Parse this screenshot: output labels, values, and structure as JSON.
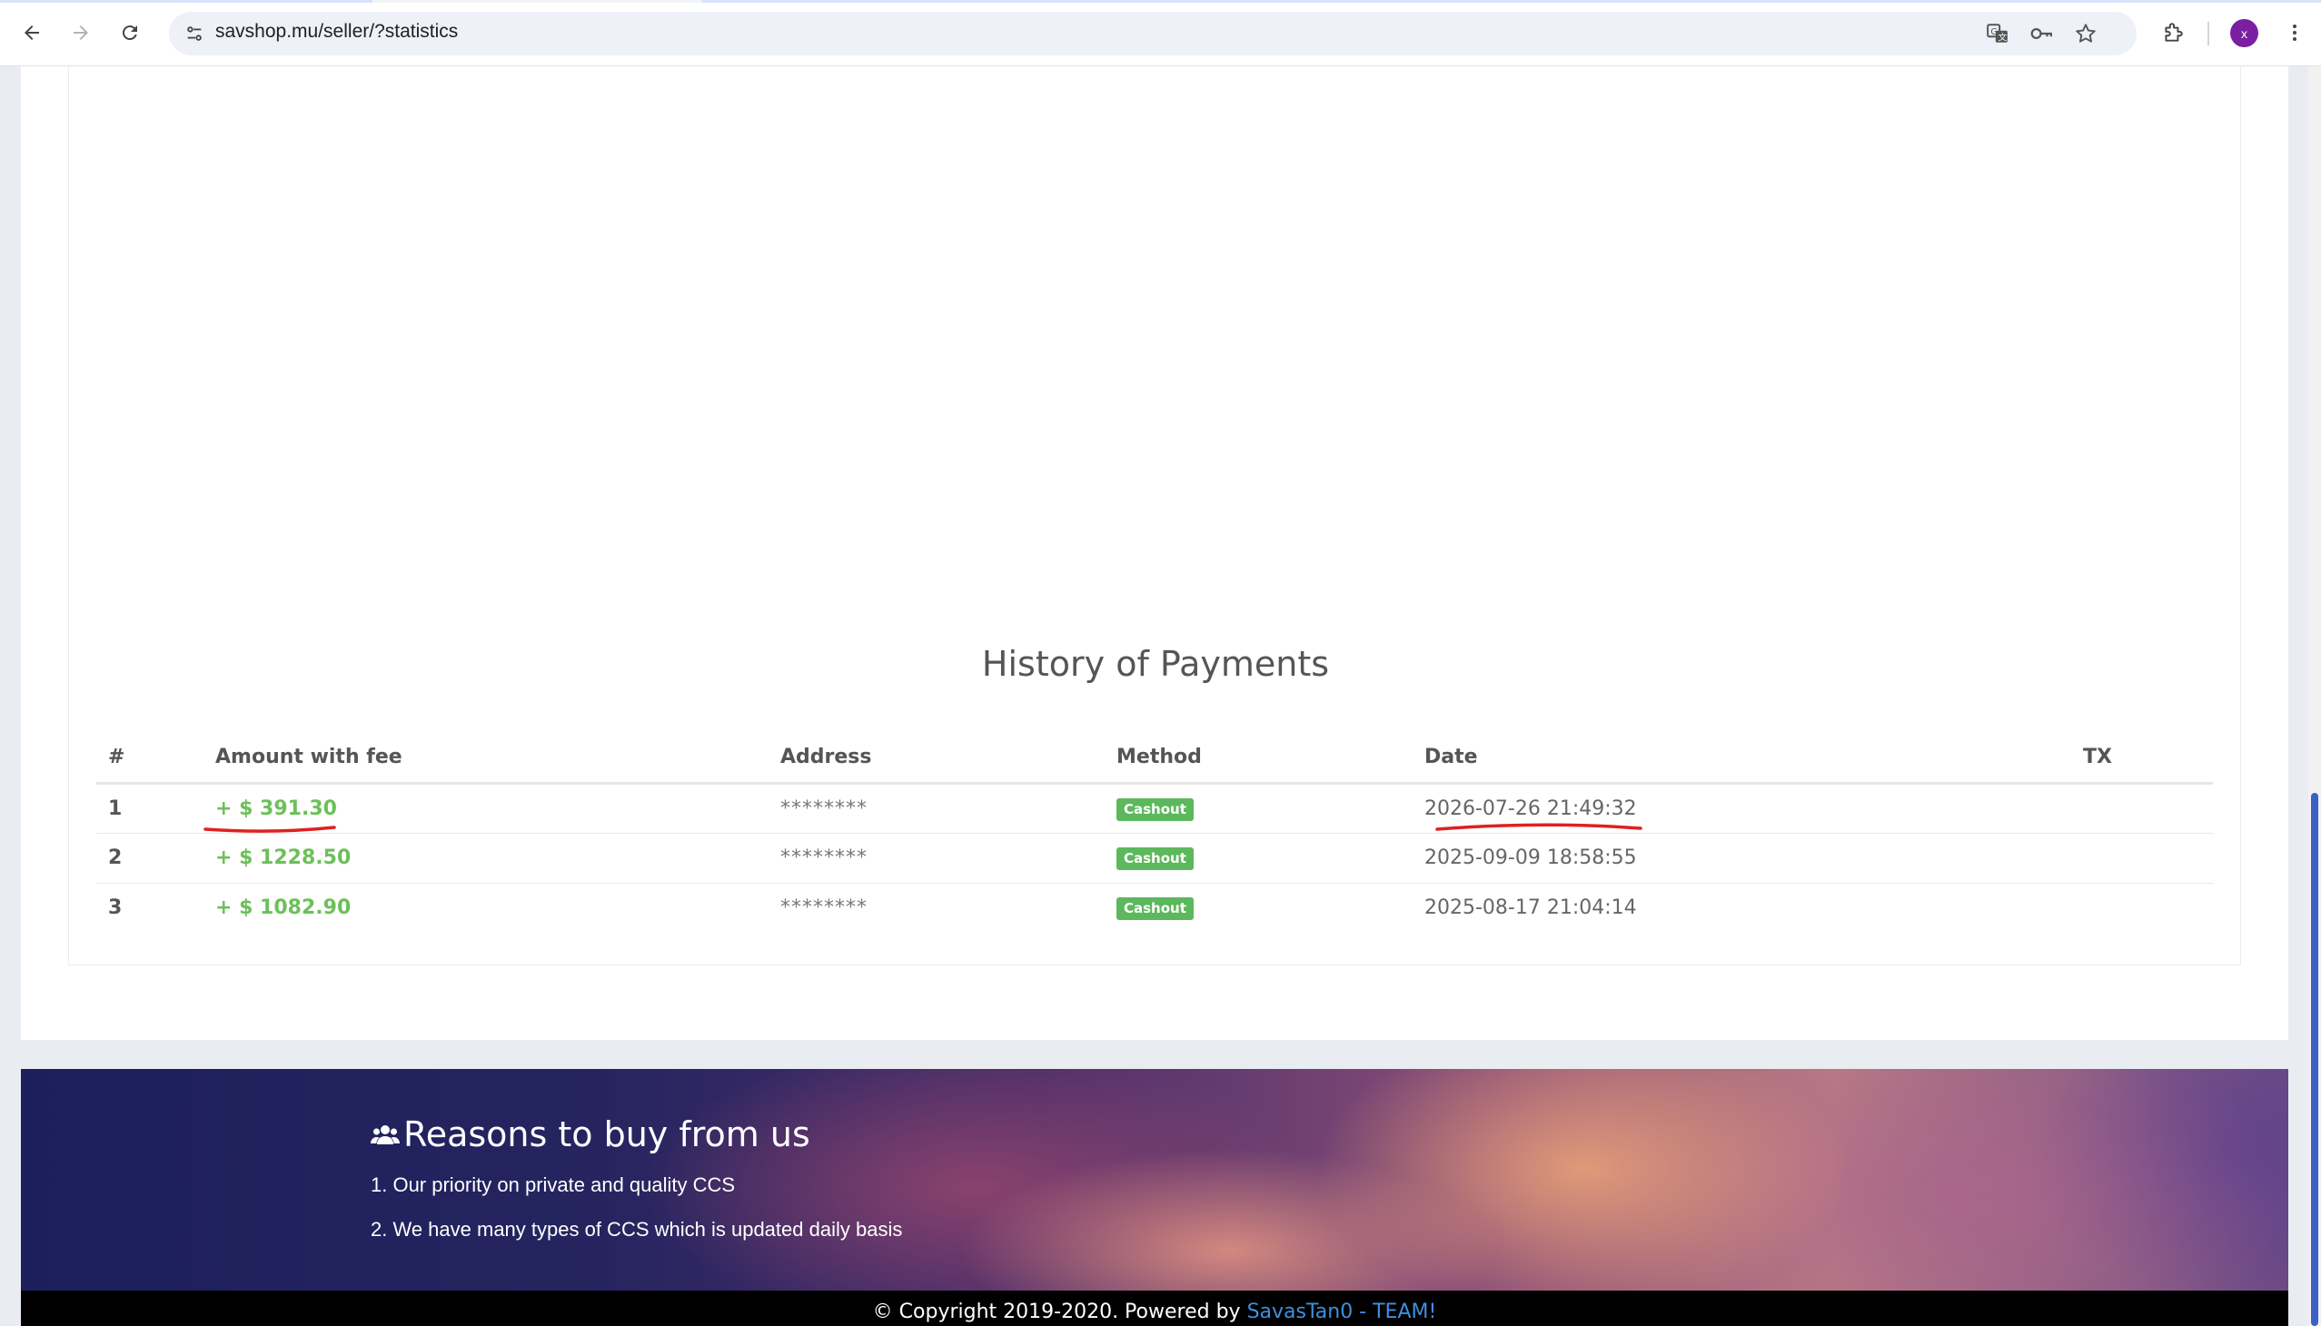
{
  "browser": {
    "url": "savshop.mu/seller/?statistics",
    "profile_initial": "x",
    "icons": [
      "back-arrow-icon",
      "forward-arrow-icon",
      "reload-icon",
      "site-info-icon",
      "translate-icon",
      "password-key-icon",
      "bookmark-star-icon",
      "extensions-puzzle-icon",
      "menu-dots-icon"
    ]
  },
  "history": {
    "title": "History of Payments",
    "columns": [
      "#",
      "Amount with fee",
      "Address",
      "Method",
      "Date",
      "TX"
    ],
    "rows": [
      {
        "num": "1",
        "amount": "+ $ 391.30",
        "address": "********",
        "method": "Cashout",
        "date": "2026-07-26 21:49:32",
        "tx": ""
      },
      {
        "num": "2",
        "amount": "+ $ 1228.50",
        "address": "********",
        "method": "Cashout",
        "date": "2025-09-09 18:58:55",
        "tx": ""
      },
      {
        "num": "3",
        "amount": "+ $ 1082.90",
        "address": "********",
        "method": "Cashout",
        "date": "2025-08-17 21:04:14",
        "tx": ""
      }
    ],
    "annotation_color": "#e02020"
  },
  "footer": {
    "reasons_title": "Reasons to buy from us",
    "reasons_icon": "users-icon",
    "reasons": [
      "1. Our priority on private and quality CCS",
      "2. We have many types of CCS which is updated daily basis"
    ],
    "copyright_text": "© Copyright 2019-2020. Powered by ",
    "copyright_link": "SavasTan0 - TEAM!"
  },
  "colors": {
    "amount_green": "#6cc05a",
    "badge_green": "#5cb85c",
    "link_blue": "#3f8fdc",
    "scroll_thumb": "#3b60c3"
  }
}
